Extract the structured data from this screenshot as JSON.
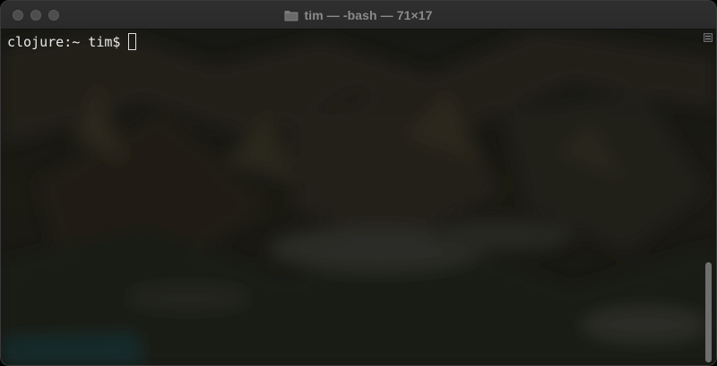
{
  "window": {
    "title": "tim — -bash — 71×17",
    "icons": {
      "close": "close-traffic-light",
      "minimize": "minimize-traffic-light",
      "maximize": "maximize-traffic-light",
      "folder": "folder-icon"
    },
    "colors": {
      "titlebar": "#2c2c2c",
      "title_text": "#8a8a8a",
      "traffic_light_inactive": "#4d4d4d",
      "terminal_text": "#e8e8e8"
    }
  },
  "terminal": {
    "prompt": "clojure:~ tim$",
    "cursor": "block-outline"
  }
}
